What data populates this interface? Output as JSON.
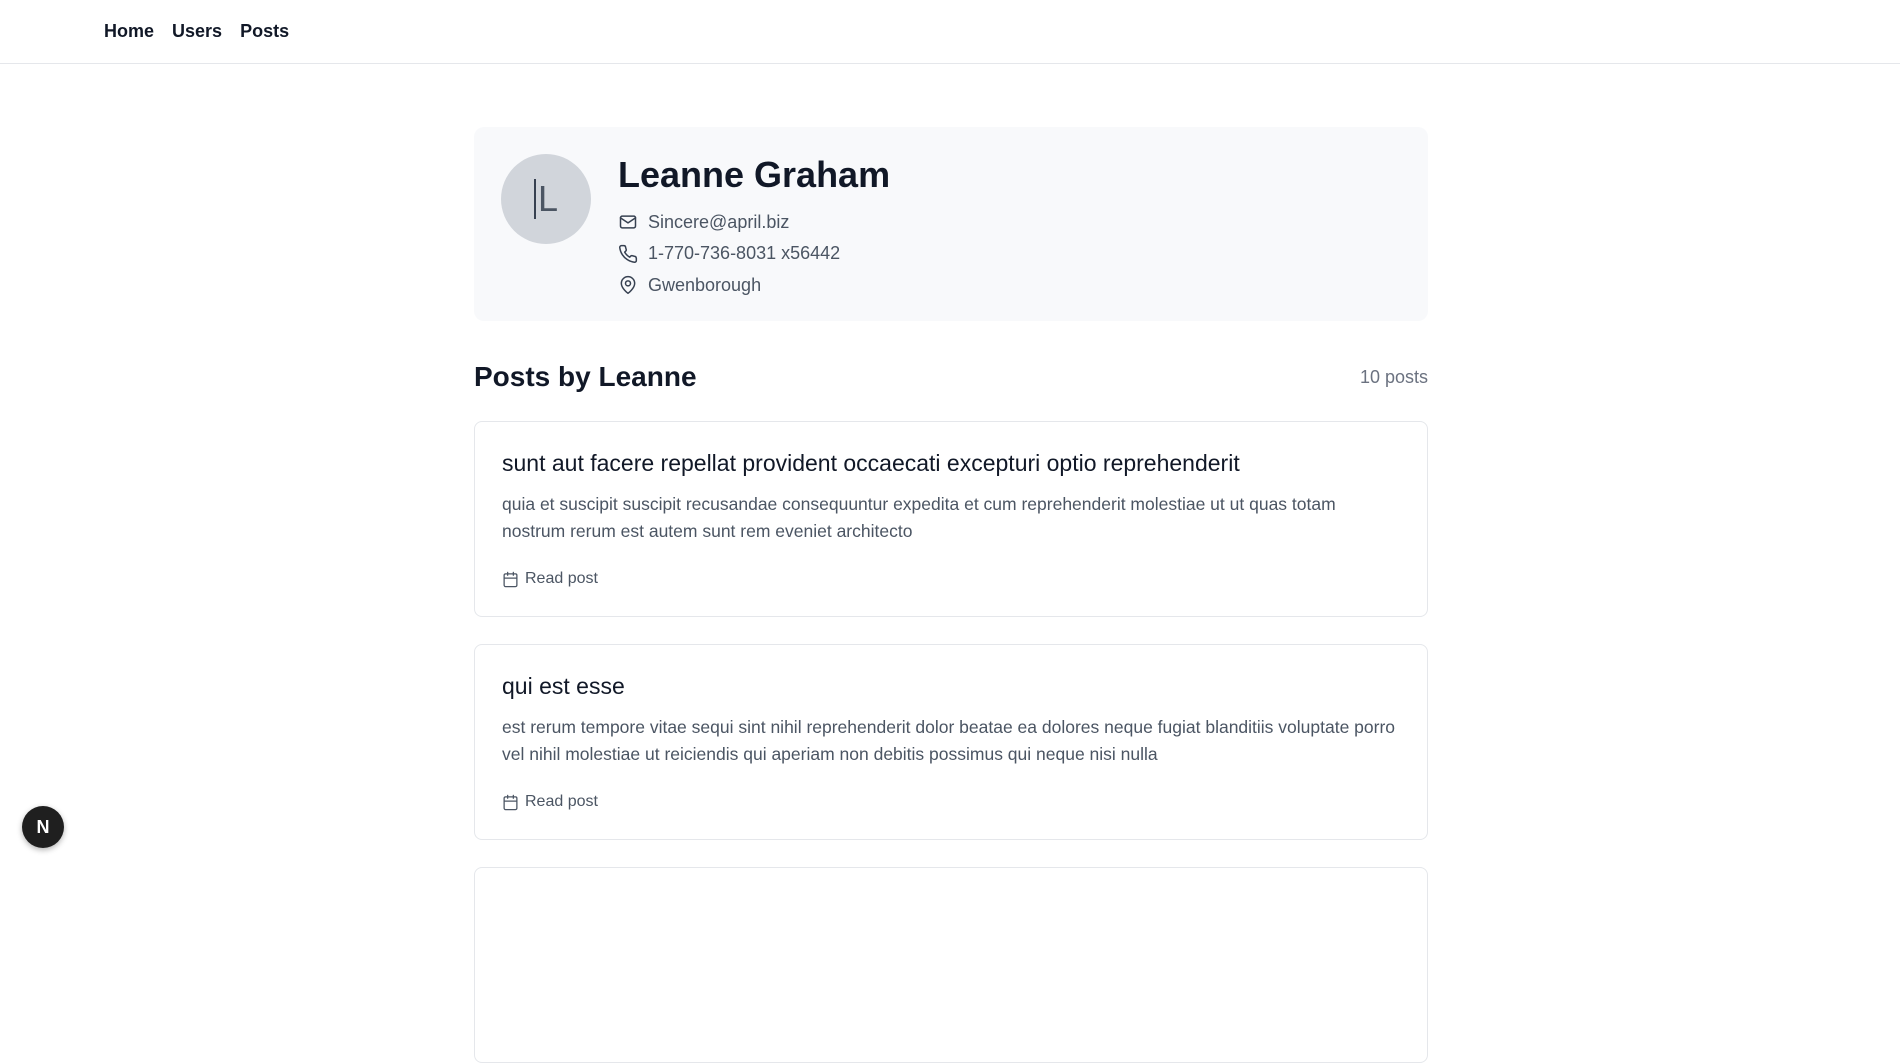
{
  "nav": {
    "home": "Home",
    "users": "Users",
    "posts": "Posts"
  },
  "profile": {
    "initial": "L",
    "name": "Leanne Graham",
    "email": "Sincere@april.biz",
    "phone": "1-770-736-8031 x56442",
    "city": "Gwenborough"
  },
  "posts_section": {
    "title": "Posts by Leanne",
    "count": "10 posts"
  },
  "posts": [
    {
      "title": "sunt aut facere repellat provident occaecati excepturi optio reprehenderit",
      "body": "quia et suscipit suscipit recusandae consequuntur expedita et cum reprehenderit molestiae ut ut quas totam nostrum rerum est autem sunt rem eveniet architecto",
      "link": "Read post"
    },
    {
      "title": "qui est esse",
      "body": "est rerum tempore vitae sequi sint nihil reprehenderit dolor beatae ea dolores neque fugiat blanditiis voluptate porro vel nihil molestiae ut reiciendis qui aperiam non debitis possimus qui neque nisi nulla",
      "link": "Read post"
    }
  ],
  "fab": {
    "label": "N"
  },
  "icons": {
    "email": "mail-icon",
    "phone": "phone-icon",
    "location": "map-pin-icon",
    "calendar": "calendar-icon"
  }
}
